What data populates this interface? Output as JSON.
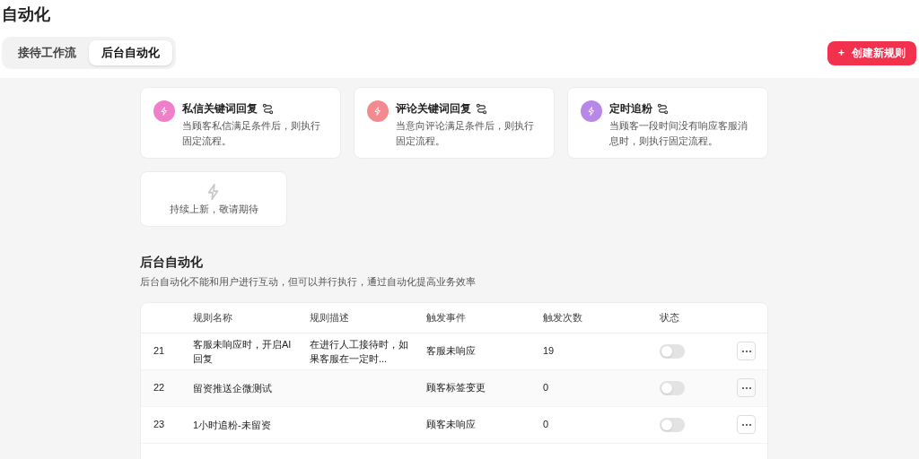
{
  "page_title": "自动化",
  "tabs": [
    {
      "label": "接待工作流",
      "selected": false
    },
    {
      "label": "后台自动化",
      "selected": true
    }
  ],
  "create_button": {
    "icon": "+",
    "label": "创建新规则"
  },
  "templates": [
    {
      "title": "私信关键词回复",
      "description": "当顾客私信满足条件后，则执行固定流程。",
      "color": "#ef7fc8"
    },
    {
      "title": "评论关键词回复",
      "description": "当意向评论满足条件后，则执行固定流程。",
      "color": "#f28a8f"
    },
    {
      "title": "定时追粉",
      "description": "当顾客一段时间没有响应客服消息时，则执行固定流程。",
      "color": "#b888e8"
    }
  ],
  "coming_soon": "持续上新，敬请期待",
  "section": {
    "title": "后台自动化",
    "subtitle": "后台自动化不能和用户进行互动，但可以并行执行，通过自动化提高业务效率"
  },
  "table": {
    "columns": [
      "规则名称",
      "规则描述",
      "触发事件",
      "触发次数",
      "状态"
    ],
    "rows": [
      {
        "id": "21",
        "name": "客服未响应时，开启AI回复",
        "description": "在进行人工接待时，如果客服在一定时...",
        "event": "客服未响应",
        "count": "19",
        "on": false
      },
      {
        "id": "22",
        "name": "留资推送企微测试",
        "description": "",
        "event": "顾客标签变更",
        "count": "0",
        "on": false
      },
      {
        "id": "23",
        "name": "1小时追粉-未留资",
        "description": "",
        "event": "顾客未响应",
        "count": "0",
        "on": false
      }
    ]
  }
}
